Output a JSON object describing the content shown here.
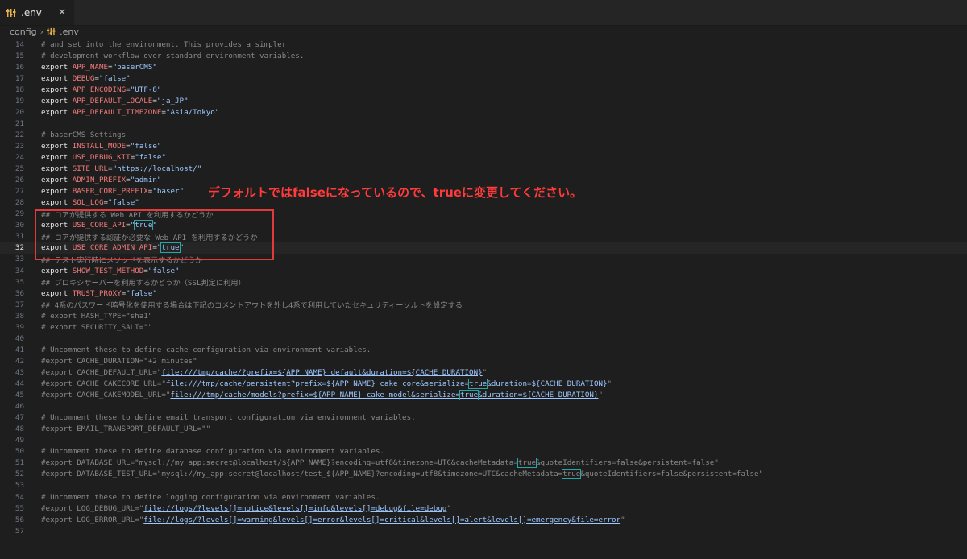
{
  "tab": {
    "label": ".env",
    "close_glyph": "✕"
  },
  "breadcrumb": {
    "folder": "config",
    "file": ".env"
  },
  "overlay": {
    "note": "デフォルトではfalseになっているので、trueに変更してください。"
  },
  "lines": [
    {
      "n": "14",
      "t": "# and set into the environment. This provides a simpler"
    },
    {
      "n": "15",
      "t": "# development workflow over standard environment variables."
    },
    {
      "n": "16",
      "t": "export APP_NAME=\"baserCMS\""
    },
    {
      "n": "17",
      "t": "export DEBUG=\"false\""
    },
    {
      "n": "18",
      "t": "export APP_ENCODING=\"UTF-8\""
    },
    {
      "n": "19",
      "t": "export APP_DEFAULT_LOCALE=\"ja_JP\""
    },
    {
      "n": "20",
      "t": "export APP_DEFAULT_TIMEZONE=\"Asia/Tokyo\""
    },
    {
      "n": "21",
      "t": ""
    },
    {
      "n": "22",
      "t": "# baserCMS Settings"
    },
    {
      "n": "23",
      "t": "export INSTALL_MODE=\"false\""
    },
    {
      "n": "24",
      "t": "export USE_DEBUG_KIT=\"false\""
    },
    {
      "n": "25",
      "t": "export SITE_URL=\"https://localhost/\""
    },
    {
      "n": "26",
      "t": "export ADMIN_PREFIX=\"admin\""
    },
    {
      "n": "27",
      "t": "export BASER_CORE_PREFIX=\"baser\""
    },
    {
      "n": "28",
      "t": "export SQL_LOG=\"false\""
    },
    {
      "n": "29",
      "t": "## コアが提供する Web API を利用するかどうか"
    },
    {
      "n": "30",
      "t": "export USE_CORE_API=\"true\""
    },
    {
      "n": "31",
      "t": "## コアが提供する認証が必要な Web API を利用するかどうか"
    },
    {
      "n": "32",
      "t": "export USE_CORE_ADMIN_API=\"true\""
    },
    {
      "n": "33",
      "t": "## テスト実行時にメソッドを表示するかどうか"
    },
    {
      "n": "34",
      "t": "export SHOW_TEST_METHOD=\"false\""
    },
    {
      "n": "35",
      "t": "## プロキシサーバーを利用するかどうか（SSL判定に利用）"
    },
    {
      "n": "36",
      "t": "export TRUST_PROXY=\"false\""
    },
    {
      "n": "37",
      "t": "## 4系のパスワード暗号化を使用する場合は下記のコメントアウトを外し4系で利用していたセキュリティーソルトを設定する"
    },
    {
      "n": "38",
      "t": "# export HASH_TYPE=\"sha1\""
    },
    {
      "n": "39",
      "t": "# export SECURITY_SALT=\"\""
    },
    {
      "n": "40",
      "t": ""
    },
    {
      "n": "41",
      "t": "# Uncomment these to define cache configuration via environment variables."
    },
    {
      "n": "42",
      "t": "#export CACHE_DURATION=\"+2 minutes\""
    },
    {
      "n": "43",
      "t": "#export CACHE_DEFAULT_URL=\"file:///tmp/cache/?prefix=${APP_NAME}_default&duration=${CACHE_DURATION}\""
    },
    {
      "n": "44",
      "t": "#export CACHE_CAKECORE_URL=\"file:///tmp/cache/persistent?prefix=${APP_NAME}_cake_core&serialize=true&duration=${CACHE_DURATION}\""
    },
    {
      "n": "45",
      "t": "#export CACHE_CAKEMODEL_URL=\"file:///tmp/cache/models?prefix=${APP_NAME}_cake_model&serialize=true&duration=${CACHE_DURATION}\""
    },
    {
      "n": "46",
      "t": ""
    },
    {
      "n": "47",
      "t": "# Uncomment these to define email transport configuration via environment variables."
    },
    {
      "n": "48",
      "t": "#export EMAIL_TRANSPORT_DEFAULT_URL=\"\""
    },
    {
      "n": "49",
      "t": ""
    },
    {
      "n": "50",
      "t": "# Uncomment these to define database configuration via environment variables."
    },
    {
      "n": "51",
      "t": "#export DATABASE_URL=\"mysql://my_app:secret@localhost/${APP_NAME}?encoding=utf8&timezone=UTC&cacheMetadata=true&quoteIdentifiers=false&persistent=false\""
    },
    {
      "n": "52",
      "t": "#export DATABASE_TEST_URL=\"mysql://my_app:secret@localhost/test_${APP_NAME}?encoding=utf8&timezone=UTC&cacheMetadata=true&quoteIdentifiers=false&persistent=false\""
    },
    {
      "n": "53",
      "t": ""
    },
    {
      "n": "54",
      "t": "# Uncomment these to define logging configuration via environment variables."
    },
    {
      "n": "55",
      "t": "#export LOG_DEBUG_URL=\"file://logs/?levels[]=notice&levels[]=info&levels[]=debug&file=debug\""
    },
    {
      "n": "56",
      "t": "#export LOG_ERROR_URL=\"file://logs/?levels[]=warning&levels[]=error&levels[]=critical&levels[]=alert&levels[]=emergency&file=error\""
    },
    {
      "n": "57",
      "t": ""
    }
  ],
  "active_line": "32",
  "colors": {
    "accent_red": "#e03a3a",
    "bg": "#1e1e1e"
  }
}
